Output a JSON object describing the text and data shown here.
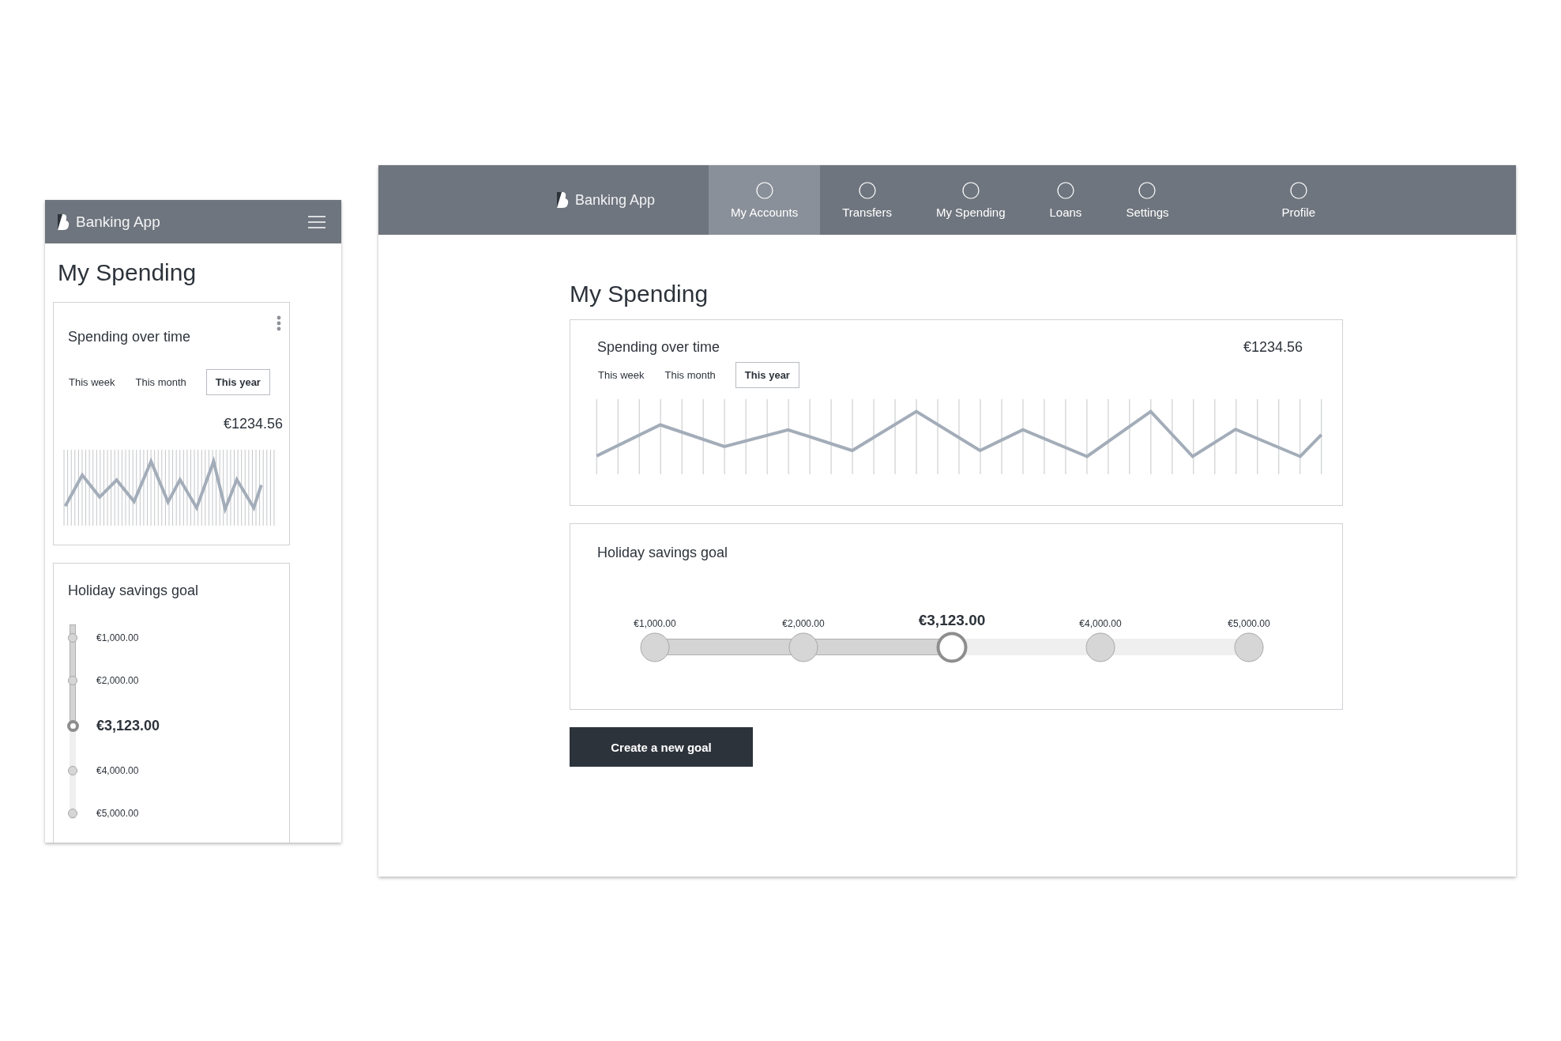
{
  "mobile": {
    "header": {
      "logo": "Banking App"
    },
    "title": "My Spending",
    "spending_card": {
      "title": "Spending over time",
      "periods": [
        {
          "label": "This week",
          "selected": false
        },
        {
          "label": "This month",
          "selected": false
        },
        {
          "label": "This year",
          "selected": true
        }
      ],
      "amount": "€1234.56"
    },
    "goal_card": {
      "title": "Holiday savings goal",
      "level": 0.5,
      "steps": [
        {
          "label": "€1,000.00",
          "selected": false
        },
        {
          "label": "€2,000.00",
          "selected": false
        },
        {
          "label": "€3,123.00",
          "selected": true
        },
        {
          "label": "€4,000.00",
          "selected": false
        },
        {
          "label": "€5,000.00",
          "selected": false
        }
      ]
    }
  },
  "desktop": {
    "nav": {
      "logo": "Banking App",
      "items": [
        {
          "label": "My Accounts",
          "selected": true
        },
        {
          "label": "Transfers",
          "selected": false
        },
        {
          "label": "My Spending",
          "selected": false
        },
        {
          "label": "Loans",
          "selected": false
        },
        {
          "label": "Settings",
          "selected": false
        }
      ],
      "profile": {
        "label": "Profile",
        "selected": false
      }
    },
    "title": "My Spending",
    "spending_card": {
      "title": "Spending over time",
      "amount": "€1234.56",
      "periods": [
        {
          "label": "This week",
          "selected": false
        },
        {
          "label": "This month",
          "selected": false
        },
        {
          "label": "This year",
          "selected": true
        }
      ]
    },
    "goal_card": {
      "title": "Holiday savings goal",
      "level": 0.5,
      "steps": [
        {
          "label": "€1,000.00",
          "selected": false
        },
        {
          "label": "€2,000.00",
          "selected": false
        },
        {
          "label": "€3,123.00",
          "selected": true
        },
        {
          "label": "€4,000.00",
          "selected": false
        },
        {
          "label": "€5,000.00",
          "selected": false
        }
      ]
    },
    "button": "Create a new goal"
  }
}
